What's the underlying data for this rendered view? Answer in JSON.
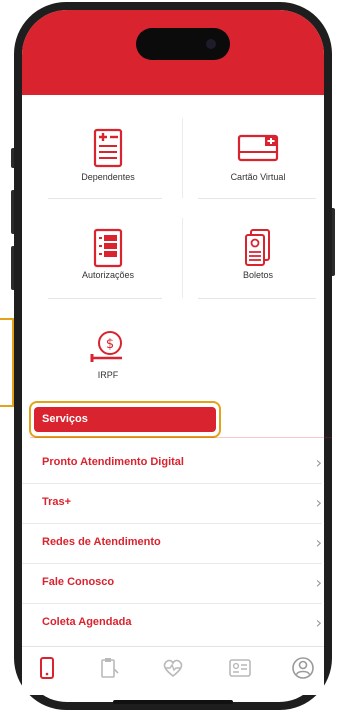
{
  "colors": {
    "brand_red": "#d9232e",
    "highlight": "#e3a21a",
    "text_dark": "#333333",
    "chevron": "#9a9a9a"
  },
  "tiles": [
    {
      "label": "Dependentes",
      "icon": "dependents-card-icon"
    },
    {
      "label": "Cartão Virtual",
      "icon": "virtual-card-icon"
    },
    {
      "label": "Autorizações",
      "icon": "authorizations-list-icon"
    },
    {
      "label": "Boletos",
      "icon": "invoices-icon"
    },
    {
      "label": "IRPF",
      "icon": "tax-coin-icon"
    }
  ],
  "services": {
    "header": "Serviços",
    "items": [
      {
        "label": "Pronto Atendimento Digital",
        "chevron": "›"
      },
      {
        "label": "Tras+",
        "chevron": "›"
      },
      {
        "label": "Redes de Atendimento",
        "chevron": "›"
      },
      {
        "label": "Fale Conosco",
        "chevron": "›"
      },
      {
        "label": "Coleta Agendada",
        "chevron": "›"
      }
    ]
  },
  "tabbar": {
    "tabs": [
      {
        "icon": "phone-icon",
        "active": true
      },
      {
        "icon": "clipboard-icon",
        "active": false
      },
      {
        "icon": "heart-pulse-icon",
        "active": false
      },
      {
        "icon": "id-card-icon",
        "active": false
      },
      {
        "icon": "user-profile-icon",
        "active": false
      }
    ]
  }
}
